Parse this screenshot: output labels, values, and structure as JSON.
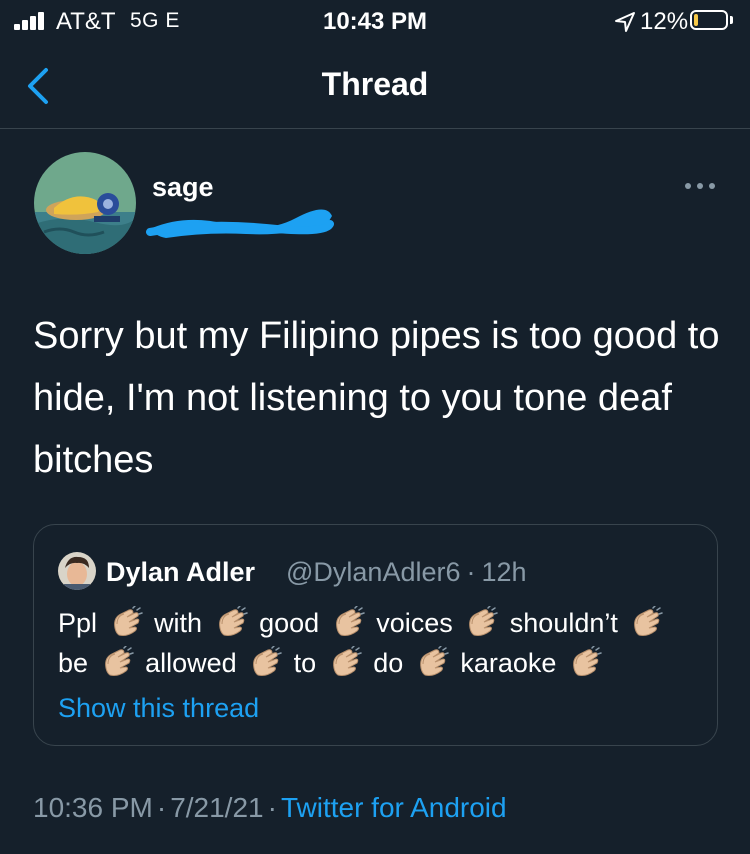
{
  "status_bar": {
    "carrier": "AT&T",
    "network": "5G E",
    "time": "10:43 PM",
    "battery_percent": "12%",
    "battery_level": 0.12,
    "icons": [
      "signal-icon",
      "location-arrow-icon",
      "battery-icon"
    ]
  },
  "nav": {
    "title": "Thread",
    "back_icon": "chevron-left-icon"
  },
  "tweet": {
    "display_name": "sage",
    "handle_redacted": true,
    "more_icon": "more-horizontal-icon",
    "text": "Sorry but my Filipino pipes is too good to hide, I'm not listening to you tone deaf bitches",
    "time": "10:36 PM",
    "date": "7/21/21",
    "source": "Twitter for Android"
  },
  "quote": {
    "display_name": "Dylan Adler",
    "handle": "@DylanAdler6",
    "age": "12h",
    "words": [
      "Ppl",
      "with",
      "good",
      "voices",
      "shouldn’t",
      "be",
      "allowed",
      "to",
      "do",
      "karaoke"
    ],
    "emoji_name": "clapping-hands-icon",
    "show_thread_label": "Show this thread"
  },
  "colors": {
    "background": "#15202b",
    "border": "#38444d",
    "secondary_text": "#8899a6",
    "accent": "#1da1f2",
    "redaction": "#1da1f2"
  }
}
